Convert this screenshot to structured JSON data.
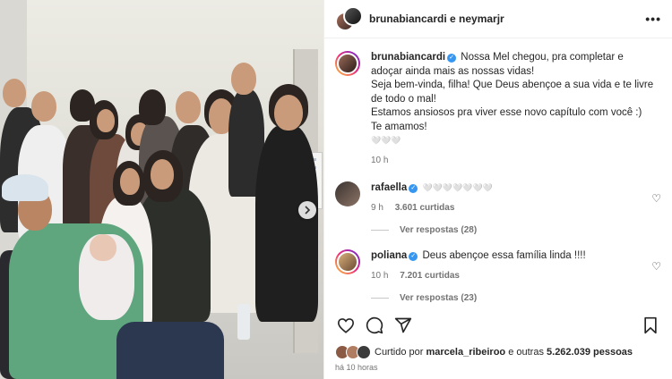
{
  "header": {
    "title": "brunabiancardi e neymarjr",
    "more_icon": "more-horizontal-icon"
  },
  "caption": {
    "username": "brunabiancardi",
    "lines": [
      "Nossa Mel chegou, pra completar e adoçar ainda mais as nossas vidas!",
      "Seja bem-vinda, filha! Que Deus abençoe a sua vida e te livre de todo o mal!",
      "Estamos ansiosos pra viver esse novo capítulo com você :)",
      "Te amamos!",
      "🤍🤍🤍"
    ],
    "time": "10 h"
  },
  "comments": [
    {
      "username": "rafaella",
      "text": "🤍🤍🤍🤍🤍🤍🤍",
      "time": "9 h",
      "likes": "3.601 curtidas",
      "replies": "Ver respostas (28)"
    },
    {
      "username": "poliana",
      "text": "Deus abençoe essa família linda !!!!",
      "time": "10 h",
      "likes": "7.201 curtidas",
      "replies": "Ver respostas (23)"
    }
  ],
  "likes": {
    "prefix": "Curtido por",
    "user": "marcela_ribeiroo",
    "suffix": "e outras",
    "count": "5.262.039 pessoas"
  },
  "posted": "há 10 horas",
  "colors": {
    "verified": "#3797f0",
    "scrub": "#5fa67f",
    "muted": "#737373"
  }
}
